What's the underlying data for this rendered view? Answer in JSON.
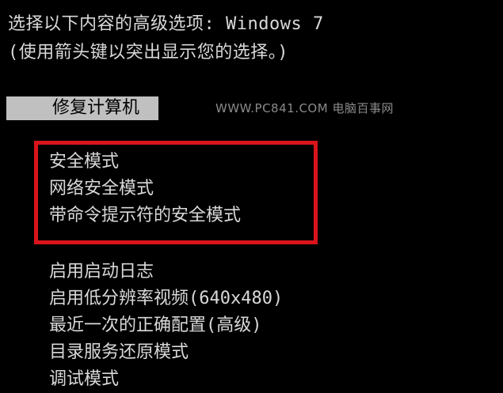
{
  "header": {
    "line1": "选择以下内容的高级选项: Windows 7",
    "line2": "(使用箭头键以突出显示您的选择。)"
  },
  "selected_option": "修复计算机",
  "watermark": "WWW.PC841.COM 电脑百事网",
  "safe_mode_options": [
    "安全模式",
    "网络安全模式",
    "带命令提示符的安全模式"
  ],
  "other_options": [
    "启用启动日志",
    "启用低分辨率视频(640x480)",
    "最近一次的正确配置(高级)",
    "目录服务还原模式",
    "调试模式"
  ],
  "colors": {
    "background": "#000000",
    "text": "#d9d9d9",
    "selection_background": "#c0c0c0",
    "highlight_border": "#d9141b"
  }
}
